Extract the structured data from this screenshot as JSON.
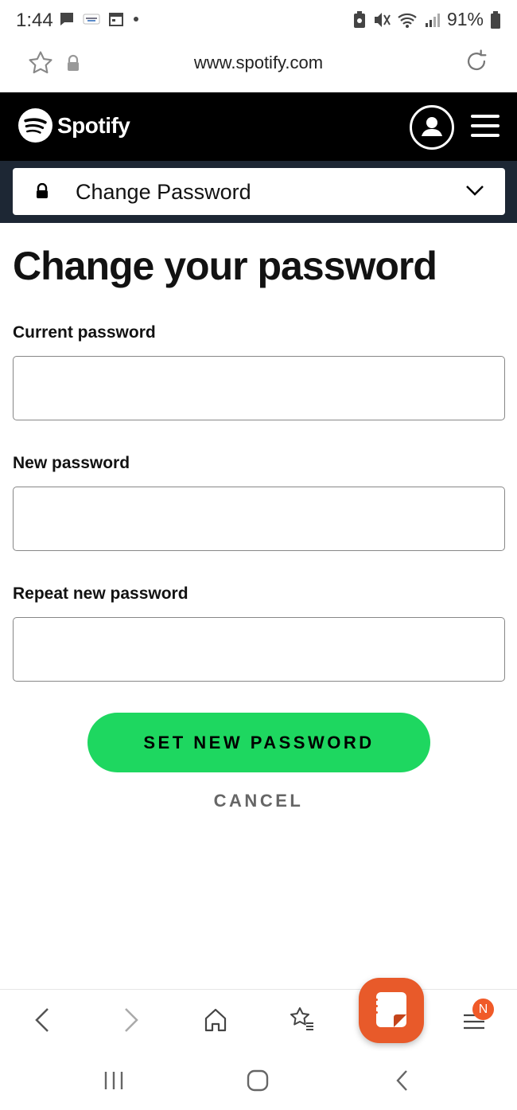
{
  "status_bar": {
    "time": "1:44",
    "battery_pct": "91%",
    "left_icons": [
      "chat-icon",
      "secret-app-icon",
      "calendar-icon",
      "dot-icon"
    ],
    "right_icons": [
      "battery-saver-icon",
      "mute-icon",
      "wifi-icon",
      "signal-icon",
      "battery-icon"
    ]
  },
  "browser": {
    "url": "www.spotify.com"
  },
  "header": {
    "brand": "Spotify",
    "colors": {
      "background": "#000000",
      "accent": "#1ed760"
    }
  },
  "section_dropdown": {
    "label": "Change Password"
  },
  "main": {
    "title": "Change your password",
    "fields": [
      {
        "label": "Current password",
        "value": ""
      },
      {
        "label": "New password",
        "value": ""
      },
      {
        "label": "Repeat new password",
        "value": ""
      }
    ],
    "submit_label": "SET NEW PASSWORD",
    "cancel_label": "CANCEL"
  },
  "bottom_nav": {
    "items": [
      "back-icon",
      "forward-icon",
      "home-icon",
      "bookmarks-icon",
      "notes-app-icon",
      "menu-icon"
    ],
    "badge": "N"
  },
  "system_nav": {
    "items": [
      "recents-icon",
      "home-button-icon",
      "back-button-icon"
    ]
  }
}
